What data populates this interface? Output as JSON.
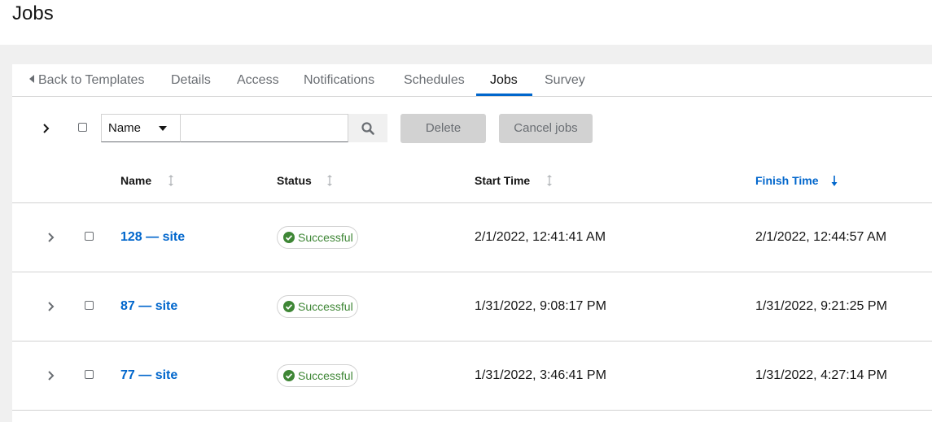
{
  "page": {
    "title": "Jobs"
  },
  "tabs": [
    {
      "label": "Back to Templates"
    },
    {
      "label": "Details"
    },
    {
      "label": "Access"
    },
    {
      "label": "Notifications"
    },
    {
      "label": "Schedules"
    },
    {
      "label": "Jobs",
      "active": true
    },
    {
      "label": "Survey"
    }
  ],
  "toolbar": {
    "filter_select": "Name",
    "search_value": "",
    "delete_label": "Delete",
    "cancel_jobs_label": "Cancel jobs"
  },
  "table": {
    "columns": [
      {
        "label": "Name"
      },
      {
        "label": "Status"
      },
      {
        "label": "Start Time"
      },
      {
        "label": "Finish Time",
        "sorted": "descending"
      }
    ],
    "rows": [
      {
        "name": "128 — site",
        "status": "Successful",
        "start_time": "2/1/2022, 12:41:41 AM",
        "finish_time": "2/1/2022, 12:44:57 AM"
      },
      {
        "name": "87 — site",
        "status": "Successful",
        "start_time": "1/31/2022, 9:08:17 PM",
        "finish_time": "1/31/2022, 9:21:25 PM"
      },
      {
        "name": "77 — site",
        "status": "Successful",
        "start_time": "1/31/2022, 3:46:41 PM",
        "finish_time": "1/31/2022, 4:27:14 PM"
      }
    ]
  },
  "colors": {
    "accent": "#0066cc",
    "success": "#3e8635",
    "border": "#d2d2d2"
  }
}
